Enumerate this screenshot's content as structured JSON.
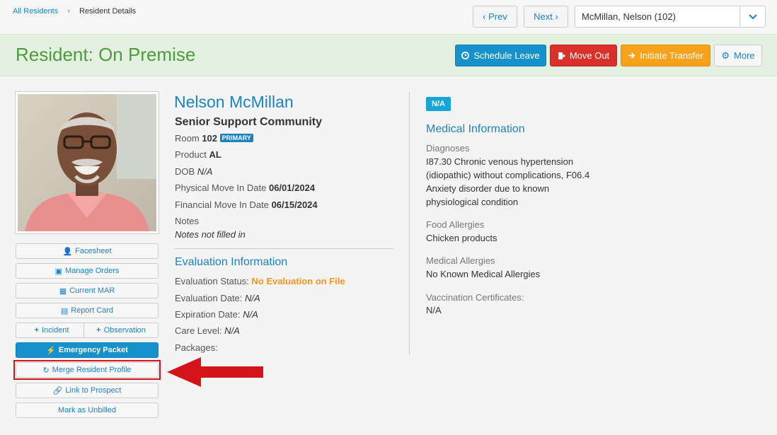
{
  "breadcrumb": {
    "home": "All Residents",
    "current": "Resident Details"
  },
  "nav": {
    "prev": "‹ Prev",
    "next": "Next ›",
    "selector_value": "McMillan, Nelson (102)"
  },
  "header": {
    "title": "Resident: On Premise",
    "schedule_leave": "Schedule Leave",
    "move_out": "Move Out",
    "initiate_transfer": "Initiate Transfer",
    "more": "More"
  },
  "side_buttons": {
    "facesheet": "Facesheet",
    "manage_orders": "Manage Orders",
    "current_mar": "Current MAR",
    "report_card": "Report Card",
    "incident": "Incident",
    "observation": "Observation",
    "emergency_packet": "Emergency Packet",
    "merge_profile": "Merge Resident Profile",
    "link_prospect": "Link to Prospect",
    "mark_unbilled": "Mark as Unbilled"
  },
  "resident": {
    "name": "Nelson McMillan",
    "community": "Senior Support Community",
    "room_label": "Room",
    "room": "102",
    "room_badge": "PRIMARY",
    "product_label": "Product",
    "product": "AL",
    "dob_label": "DOB",
    "dob": "N/A",
    "physical_label": "Physical Move In Date",
    "physical_date": "06/01/2024",
    "financial_label": "Financial Move In Date",
    "financial_date": "06/15/2024",
    "notes_label": "Notes",
    "notes": "Notes not filled in"
  },
  "evaluation": {
    "heading": "Evaluation Information",
    "status_label": "Evaluation Status:",
    "status": "No Evaluation on File",
    "date_label": "Evaluation Date:",
    "date": "N/A",
    "expiration_label": "Expiration Date:",
    "expiration": "N/A",
    "care_label": "Care Level:",
    "care": "N/A",
    "packages_label": "Packages:"
  },
  "medical": {
    "badge": "N/A",
    "heading": "Medical Information",
    "diagnoses_label": "Diagnoses",
    "diagnoses": "I87.30 Chronic venous hypertension (idiopathic) without complications, F06.4 Anxiety disorder due to known physiological condition",
    "food_label": "Food Allergies",
    "food": "Chicken products",
    "med_allergy_label": "Medical Allergies",
    "med_allergy": "No Known Medical Allergies",
    "vacc_label": "Vaccination Certificates:",
    "vacc": "N/A"
  },
  "icons": {
    "facesheet": "user-icon",
    "orders": "camera-icon",
    "mar": "calendar-icon",
    "report": "file-icon",
    "add": "plus-icon",
    "emergency": "bolt-icon",
    "merge": "refresh-icon",
    "link": "link-icon",
    "schedule": "clock-icon",
    "moveout": "exit-icon",
    "transfer": "arrow-right-icon",
    "more": "gear-icon"
  },
  "colors": {
    "accent": "#1b82c3",
    "green_title": "#4e9a3f",
    "danger": "#d9302a",
    "warning": "#f7a21a",
    "highlight": "#d5131a"
  }
}
